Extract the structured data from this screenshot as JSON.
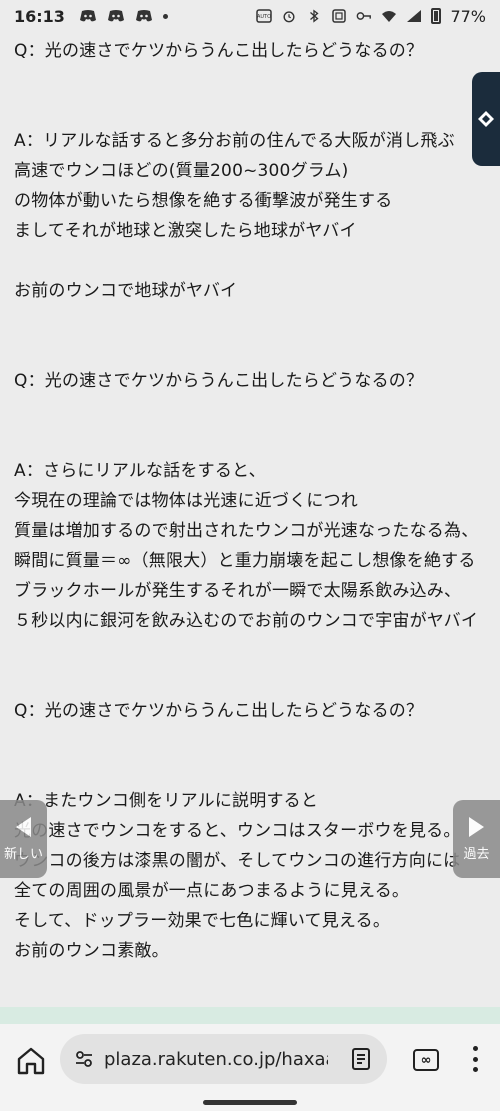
{
  "status_bar": {
    "time": "16:13",
    "battery_percent": "77%",
    "icons": [
      "discord-icon",
      "discord-icon",
      "discord-icon",
      "dot-icon",
      "auto-icon",
      "alarm-icon",
      "bluetooth-icon",
      "nfc-icon",
      "key-icon",
      "wifi-icon",
      "signal-icon",
      "battery-icon"
    ]
  },
  "article": {
    "lines": [
      "Q：光の速さでケツからうんこ出したらどうなるの？",
      "",
      "",
      "A：リアルな話すると多分お前の住んでる大阪が消し飛ぶ",
      "高速でウンコほどの(質量200~300グラム)",
      "の物体が動いたら想像を絶する衝撃波が発生する",
      "ましてそれが地球と激突したら地球がヤバイ",
      "",
      "お前のウンコで地球がヤバイ",
      "",
      "",
      "Q：光の速さでケツからうんこ出したらどうなるの？",
      "",
      "",
      "A：さらにリアルな話をすると、",
      "今現在の理論では物体は光速に近づくにつれ",
      "質量は増加するので射出されたウンコが光速なったなる為、",
      "瞬間に質量＝∞（無限大）と重力崩壊を起こし想像を絶する",
      "ブラックホールが発生するそれが一瞬で太陽系飲み込み、",
      "５秒以内に銀河を飲み込むのでお前のウンコで宇宙がヤバイ",
      "",
      "",
      "Q：光の速さでケツからうんこ出したらどうなるの？",
      "",
      "",
      "A：またウンコ側をリアルに説明すると",
      "光の速さでウンコをすると、ウンコはスターボウを見る。",
      "ウンコの後方は漆黒の闇が、そしてウンコの進行方向には",
      "全ての周囲の風景が一点にあつまるように見える。",
      "そして、ドップラー効果で七色に輝いて見える。",
      "お前のウンコ素敵。"
    ]
  },
  "nav": {
    "prev_label": "新しい",
    "next_label": "過去"
  },
  "browser": {
    "url": "plaza.rakuten.co.jp/haxaaaa",
    "tabs_label": "∞"
  },
  "colors": {
    "background": "#ececec",
    "float_tab": "#1b2c3c",
    "nav_button": "#8a8a8a",
    "green_band": "#d8ebe2"
  }
}
